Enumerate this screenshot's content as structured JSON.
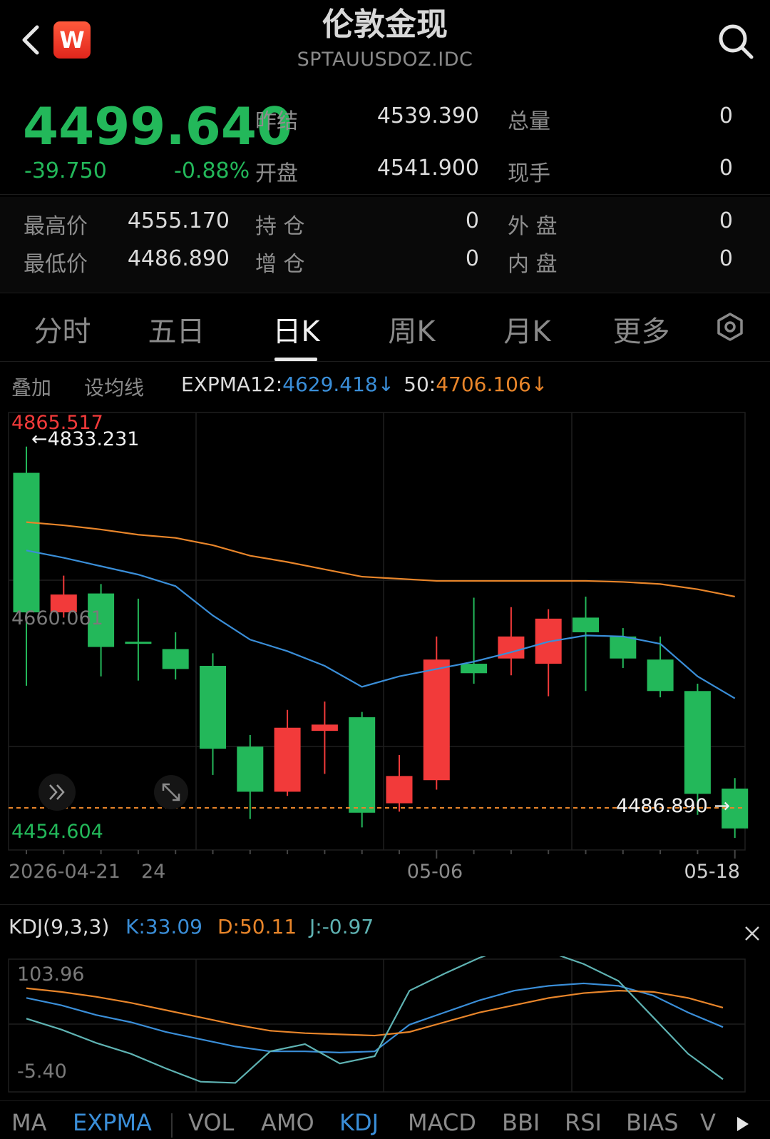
{
  "header": {
    "title": "伦敦金现",
    "symbol": "SPTAUUSDOZ.IDC",
    "logo_letter": "W",
    "back_icon": "chevron-left-icon",
    "search_icon": "search-icon"
  },
  "quote": {
    "price": "4499.640",
    "change": "-39.750",
    "change_pct": "-0.88%",
    "prev_settle_label": "昨结",
    "prev_settle": "4539.390",
    "total_volume_label": "总量",
    "total_volume": "0",
    "open_label": "开盘",
    "open": "4541.900",
    "current_hand_label": "现手",
    "current_hand": "0",
    "high_label": "最高价",
    "high": "4555.170",
    "open_interest_label": "持 仓",
    "open_interest": "0",
    "outer_label": "外 盘",
    "outer": "0",
    "low_label": "最低价",
    "low": "4486.890",
    "oi_change_label": "增 仓",
    "oi_change": "0",
    "inner_label": "内 盘",
    "inner": "0"
  },
  "tabs": [
    {
      "label": "分时"
    },
    {
      "label": "五日"
    },
    {
      "label": "日K"
    },
    {
      "label": "周K"
    },
    {
      "label": "月K"
    },
    {
      "label": "更多"
    }
  ],
  "tab_active": "日K",
  "settings_icon": "hexagon-gear-icon",
  "overlay": {
    "overlay_label": "叠加",
    "set_ma_label": "设均线",
    "expma_label": "EXPMA12",
    "expma12_value": "4629.418",
    "expma50_label": "50",
    "expma50_value": "4706.106",
    "down_arrow": "↓"
  },
  "kline": {
    "axis_top": "4865.517",
    "axis_mid": "4660.061",
    "axis_bottom": "4454.604",
    "max_marker": "4833.231",
    "min_marker": "4486.890",
    "dates": [
      "2026-04-21",
      "24",
      "05-06",
      "05-18"
    ],
    "expand_icon": "double-chevron-right-icon",
    "fullscreen_icon": "expand-arrows-icon"
  },
  "chart_data": [
    {
      "type": "candlestick",
      "title": "",
      "ylim": [
        4454.604,
        4865.517
      ],
      "candles": [
        {
          "open": 4808,
          "close": 4675,
          "high": 4833,
          "low": 4605
        },
        {
          "open": 4675,
          "close": 4692,
          "high": 4710,
          "low": 4670
        },
        {
          "open": 4693,
          "close": 4642,
          "high": 4702,
          "low": 4614
        },
        {
          "open": 4647,
          "close": 4646,
          "high": 4688,
          "low": 4610
        },
        {
          "open": 4640,
          "close": 4621,
          "high": 4656,
          "low": 4611
        },
        {
          "open": 4624,
          "close": 4545,
          "high": 4636,
          "low": 4520
        },
        {
          "open": 4547,
          "close": 4504,
          "high": 4558,
          "low": 4478
        },
        {
          "open": 4504,
          "close": 4565,
          "high": 4582,
          "low": 4500
        },
        {
          "open": 4562,
          "close": 4568,
          "high": 4590,
          "low": 4521
        },
        {
          "open": 4575,
          "close": 4484,
          "high": 4580,
          "low": 4470
        },
        {
          "open": 4493,
          "close": 4519,
          "high": 4539,
          "low": 4485
        },
        {
          "open": 4515,
          "close": 4630,
          "high": 4652,
          "low": 4506
        },
        {
          "open": 4626,
          "close": 4617,
          "high": 4689,
          "low": 4607
        },
        {
          "open": 4631,
          "close": 4652,
          "high": 4680,
          "low": 4615
        },
        {
          "open": 4626,
          "close": 4669,
          "high": 4678,
          "low": 4595
        },
        {
          "open": 4670,
          "close": 4656,
          "high": 4690,
          "low": 4600
        },
        {
          "open": 4652,
          "close": 4631,
          "high": 4660,
          "low": 4622
        },
        {
          "open": 4630,
          "close": 4600,
          "high": 4652,
          "low": 4594
        },
        {
          "open": 4600,
          "close": 4502,
          "high": 4607,
          "low": 4482
        },
        {
          "open": 4507,
          "close": 4469,
          "high": 4517,
          "low": 4460
        }
      ],
      "series": [
        {
          "name": "EXPMA12",
          "color": "#3a8ed8",
          "values": [
            4734,
            4727,
            4719,
            4711,
            4700,
            4672,
            4649,
            4638,
            4624,
            4604,
            4614,
            4621,
            4628,
            4637,
            4647,
            4653,
            4652,
            4645,
            4614,
            4593
          ]
        },
        {
          "name": "50",
          "color": "#e8852a",
          "values": [
            4761,
            4758,
            4754,
            4749,
            4746,
            4739,
            4729,
            4723,
            4716,
            4709,
            4707,
            4705,
            4705,
            4705,
            4705,
            4705,
            4704,
            4702,
            4697,
            4690
          ]
        }
      ]
    },
    {
      "type": "line",
      "title": "KDJ(9,3,3)",
      "ylim": [
        -5.4,
        103.96
      ],
      "series": [
        {
          "name": "K",
          "color": "#3a8ed8",
          "values": [
            72,
            66,
            58,
            52,
            44,
            38,
            32,
            28,
            28,
            27,
            28,
            50,
            60,
            70,
            78,
            82,
            84,
            82,
            74,
            60,
            48
          ]
        },
        {
          "name": "D",
          "color": "#e8852a",
          "values": [
            80,
            77,
            73,
            68,
            62,
            56,
            50,
            45,
            43,
            42,
            41,
            44,
            52,
            60,
            66,
            72,
            76,
            78,
            77,
            72,
            64
          ]
        },
        {
          "name": "J",
          "color": "#5fb3b3",
          "values": [
            55,
            46,
            35,
            26,
            14,
            3,
            2,
            28,
            34,
            18,
            24,
            78,
            92,
            105,
            115,
            110,
            100,
            86,
            56,
            26,
            5
          ]
        }
      ]
    }
  ],
  "kdj": {
    "label": "KDJ(9,3,3)",
    "k": "K:33.09",
    "d": "D:50.11",
    "j": "J:-0.97",
    "axis_top": "103.96",
    "axis_bottom": "-5.40",
    "close_icon": "close-icon"
  },
  "indicators": [
    "MA",
    "EXPMA",
    "VOL",
    "AMO",
    "KDJ",
    "MACD",
    "BBI",
    "RSI",
    "BIAS",
    "V"
  ],
  "indicators_active": [
    "EXPMA",
    "KDJ"
  ],
  "play_icon": "play-icon",
  "colors": {
    "up": "#f23a3a",
    "down": "#23b85a",
    "expma12": "#3a8ed8",
    "expma50": "#e8852a",
    "dash": "#e8852a"
  }
}
